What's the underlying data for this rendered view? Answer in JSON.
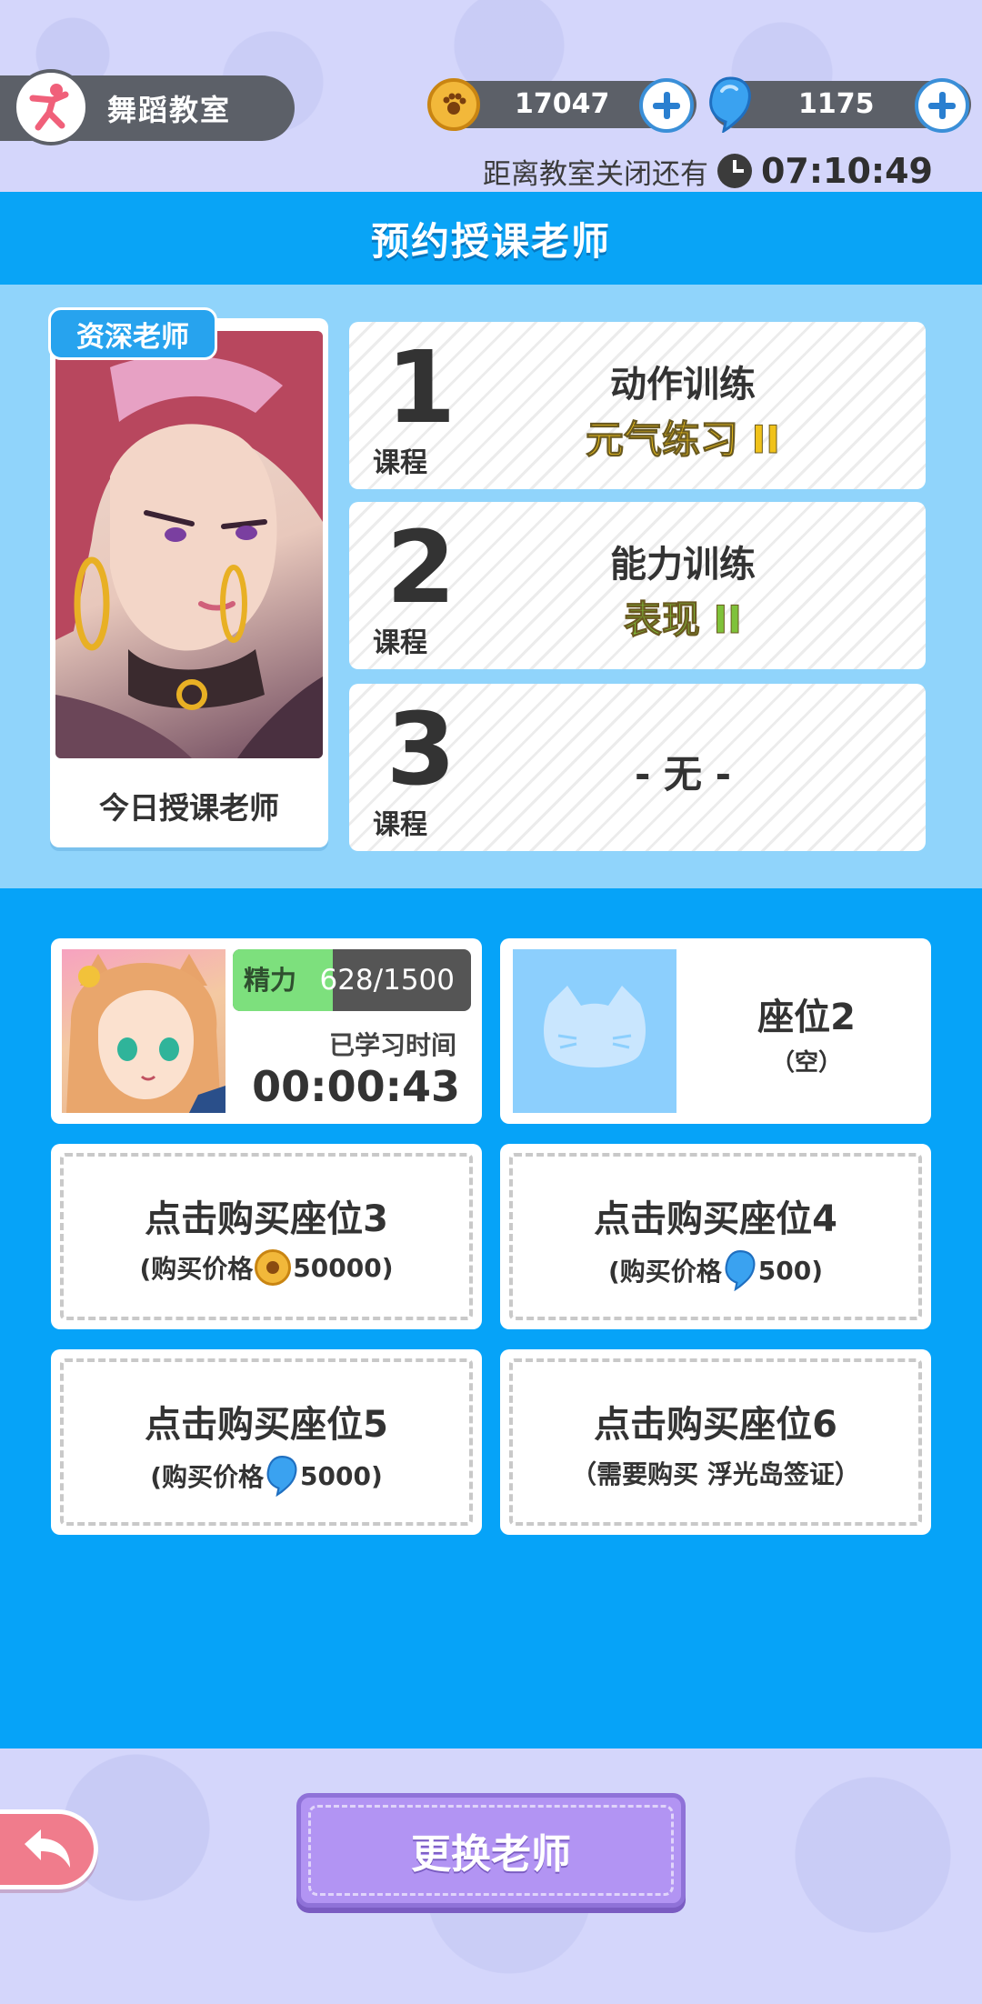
{
  "header": {
    "room_title": "舞蹈教室",
    "coins": "17047",
    "gems": "1175",
    "countdown_label": "距离教室关闭还有",
    "countdown_time": "07:10:49"
  },
  "panel": {
    "title": "预约授课老师"
  },
  "teacher": {
    "tag": "资深老师",
    "caption": "今日授课老师"
  },
  "courses": [
    {
      "number": "1",
      "sub": "课程",
      "type": "动作训练",
      "item": "元气练习 II",
      "item_color": "#f0c21a"
    },
    {
      "number": "2",
      "sub": "课程",
      "type": "能力训练",
      "item": "表现 II",
      "item_color": "#7fc23a"
    },
    {
      "number": "3",
      "sub": "课程",
      "empty": "- 无 -"
    }
  ],
  "seats": {
    "seat1": {
      "energy_label": "精力",
      "energy_value": "628/1500",
      "energy_fraction": 0.42,
      "study_label": "已学习时间",
      "study_time": "00:00:43"
    },
    "seat2": {
      "name": "座位2",
      "state": "（空）"
    },
    "seat3": {
      "title": "点击购买座位3",
      "price_prefix": "(购买价格",
      "price": "50000)",
      "currency": "coin"
    },
    "seat4": {
      "title": "点击购买座位4",
      "price_prefix": "(购买价格",
      "price": "500)",
      "currency": "gem"
    },
    "seat5": {
      "title": "点击购买座位5",
      "price_prefix": "(购买价格",
      "price": "5000)",
      "currency": "gem"
    },
    "seat6": {
      "title": "点击购买座位6",
      "requirement": "（需要购买 浮光岛签证）"
    }
  },
  "footer": {
    "change_teacher": "更换老师"
  }
}
